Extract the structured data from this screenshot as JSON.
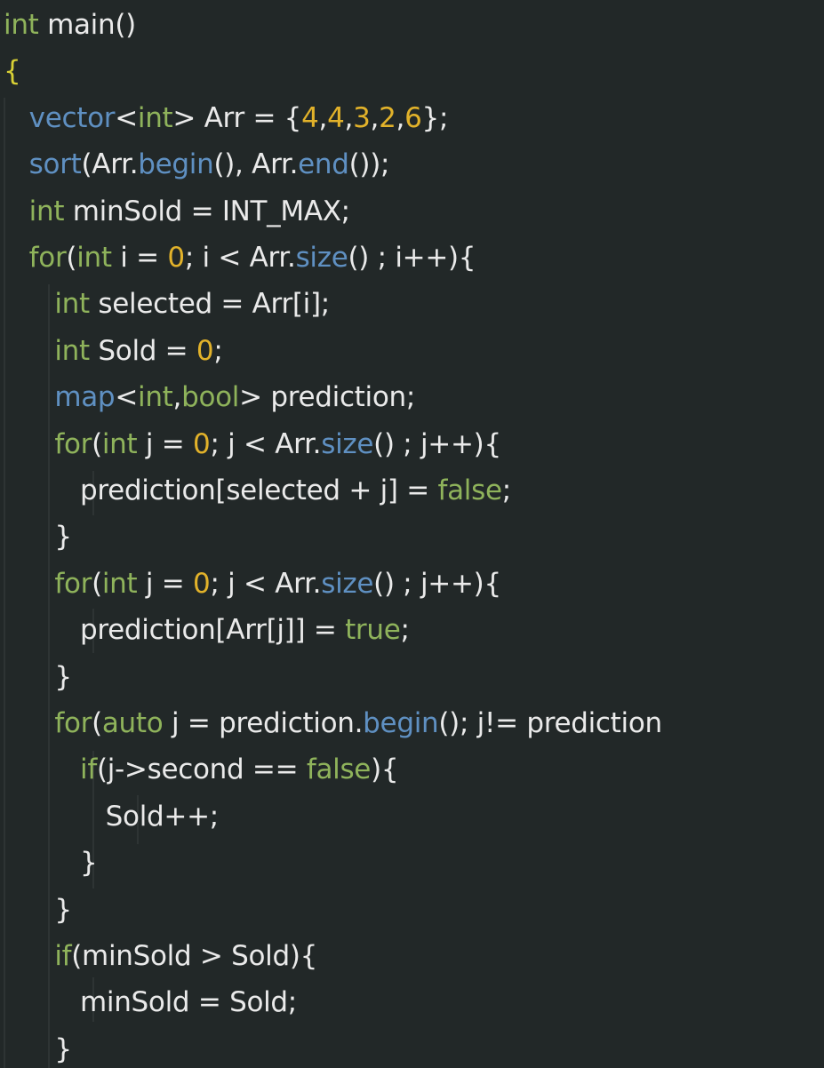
{
  "editor": {
    "language": "cpp",
    "theme_colors": {
      "background": "#222828",
      "keyword": "#8fb35b",
      "function": "#5f90c2",
      "number": "#e2b22a",
      "plain": "#eaeaea"
    },
    "lines": [
      [
        {
          "t": "int",
          "c": "keyword"
        },
        {
          "t": " main()",
          "c": "plain"
        }
      ],
      [
        {
          "t": "{",
          "c": "brace"
        }
      ],
      [
        {
          "t": "   ",
          "c": "plain"
        },
        {
          "t": "vector",
          "c": "func"
        },
        {
          "t": "<",
          "c": "plain"
        },
        {
          "t": "int",
          "c": "keyword"
        },
        {
          "t": "> Arr = {",
          "c": "plain"
        },
        {
          "t": "4",
          "c": "number"
        },
        {
          "t": ",",
          "c": "plain"
        },
        {
          "t": "4",
          "c": "number"
        },
        {
          "t": ",",
          "c": "plain"
        },
        {
          "t": "3",
          "c": "number"
        },
        {
          "t": ",",
          "c": "plain"
        },
        {
          "t": "2",
          "c": "number"
        },
        {
          "t": ",",
          "c": "plain"
        },
        {
          "t": "6",
          "c": "number"
        },
        {
          "t": "};",
          "c": "plain"
        }
      ],
      [
        {
          "t": "   ",
          "c": "plain"
        },
        {
          "t": "sort",
          "c": "func"
        },
        {
          "t": "(Arr.",
          "c": "plain"
        },
        {
          "t": "begin",
          "c": "func"
        },
        {
          "t": "(), Arr.",
          "c": "plain"
        },
        {
          "t": "end",
          "c": "func"
        },
        {
          "t": "());",
          "c": "plain"
        }
      ],
      [
        {
          "t": "   ",
          "c": "plain"
        },
        {
          "t": "int",
          "c": "keyword"
        },
        {
          "t": " minSold = INT_MAX;",
          "c": "plain"
        }
      ],
      [
        {
          "t": "   ",
          "c": "plain"
        },
        {
          "t": "for",
          "c": "keyword"
        },
        {
          "t": "(",
          "c": "plain"
        },
        {
          "t": "int",
          "c": "keyword"
        },
        {
          "t": " i = ",
          "c": "plain"
        },
        {
          "t": "0",
          "c": "number"
        },
        {
          "t": "; i < Arr.",
          "c": "plain"
        },
        {
          "t": "size",
          "c": "func"
        },
        {
          "t": "() ; i++){",
          "c": "plain"
        }
      ],
      [
        {
          "t": "      ",
          "c": "plain"
        },
        {
          "t": "int",
          "c": "keyword"
        },
        {
          "t": " selected = Arr[i];",
          "c": "plain"
        }
      ],
      [
        {
          "t": "      ",
          "c": "plain"
        },
        {
          "t": "int",
          "c": "keyword"
        },
        {
          "t": " Sold = ",
          "c": "plain"
        },
        {
          "t": "0",
          "c": "number"
        },
        {
          "t": ";",
          "c": "plain"
        }
      ],
      [
        {
          "t": "      ",
          "c": "plain"
        },
        {
          "t": "map",
          "c": "func"
        },
        {
          "t": "<",
          "c": "plain"
        },
        {
          "t": "int",
          "c": "keyword"
        },
        {
          "t": ",",
          "c": "plain"
        },
        {
          "t": "bool",
          "c": "keyword"
        },
        {
          "t": "> prediction;",
          "c": "plain"
        }
      ],
      [
        {
          "t": "      ",
          "c": "plain"
        },
        {
          "t": "for",
          "c": "keyword"
        },
        {
          "t": "(",
          "c": "plain"
        },
        {
          "t": "int",
          "c": "keyword"
        },
        {
          "t": " j = ",
          "c": "plain"
        },
        {
          "t": "0",
          "c": "number"
        },
        {
          "t": "; j < Arr.",
          "c": "plain"
        },
        {
          "t": "size",
          "c": "func"
        },
        {
          "t": "() ; j++){",
          "c": "plain"
        }
      ],
      [
        {
          "t": "         ",
          "c": "plain"
        },
        {
          "t": "prediction[selected + j] = ",
          "c": "plain"
        },
        {
          "t": "false",
          "c": "keyword"
        },
        {
          "t": ";",
          "c": "plain"
        }
      ],
      [
        {
          "t": "      ",
          "c": "plain"
        },
        {
          "t": "}",
          "c": "plain"
        }
      ],
      [
        {
          "t": "      ",
          "c": "plain"
        },
        {
          "t": "for",
          "c": "keyword"
        },
        {
          "t": "(",
          "c": "plain"
        },
        {
          "t": "int",
          "c": "keyword"
        },
        {
          "t": " j = ",
          "c": "plain"
        },
        {
          "t": "0",
          "c": "number"
        },
        {
          "t": "; j < Arr.",
          "c": "plain"
        },
        {
          "t": "size",
          "c": "func"
        },
        {
          "t": "() ; j++){",
          "c": "plain"
        }
      ],
      [
        {
          "t": "         ",
          "c": "plain"
        },
        {
          "t": "prediction[Arr[j]] = ",
          "c": "plain"
        },
        {
          "t": "true",
          "c": "keyword"
        },
        {
          "t": ";",
          "c": "plain"
        }
      ],
      [
        {
          "t": "      ",
          "c": "plain"
        },
        {
          "t": "}",
          "c": "plain"
        }
      ],
      [
        {
          "t": "      ",
          "c": "plain"
        },
        {
          "t": "for",
          "c": "keyword"
        },
        {
          "t": "(",
          "c": "plain"
        },
        {
          "t": "auto",
          "c": "keyword"
        },
        {
          "t": " j = prediction.",
          "c": "plain"
        },
        {
          "t": "begin",
          "c": "func"
        },
        {
          "t": "(); j!= prediction",
          "c": "plain"
        }
      ],
      [
        {
          "t": "         ",
          "c": "plain"
        },
        {
          "t": "if",
          "c": "keyword"
        },
        {
          "t": "(j->second == ",
          "c": "plain"
        },
        {
          "t": "false",
          "c": "keyword"
        },
        {
          "t": "){",
          "c": "plain"
        }
      ],
      [
        {
          "t": "            ",
          "c": "plain"
        },
        {
          "t": "Sold++;",
          "c": "plain"
        }
      ],
      [
        {
          "t": "         ",
          "c": "plain"
        },
        {
          "t": "}",
          "c": "plain"
        }
      ],
      [
        {
          "t": "      ",
          "c": "plain"
        },
        {
          "t": "}",
          "c": "plain"
        }
      ],
      [
        {
          "t": "      ",
          "c": "plain"
        },
        {
          "t": "if",
          "c": "keyword"
        },
        {
          "t": "(minSold > Sold){",
          "c": "plain"
        }
      ],
      [
        {
          "t": "         ",
          "c": "plain"
        },
        {
          "t": "minSold = Sold;",
          "c": "plain"
        }
      ],
      [
        {
          "t": "      ",
          "c": "plain"
        },
        {
          "t": "}",
          "c": "plain"
        }
      ]
    ]
  }
}
